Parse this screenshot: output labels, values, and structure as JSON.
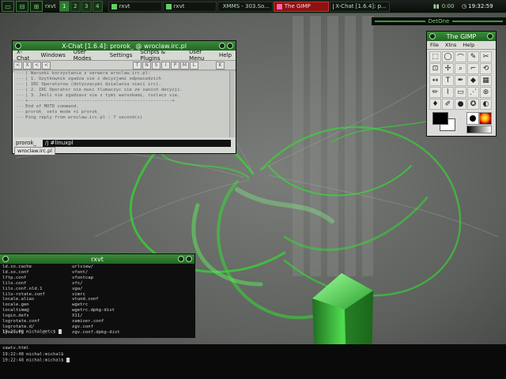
{
  "top_panel": {
    "desktop_label": "rxvt",
    "desktops": [
      "1",
      "2",
      "3",
      "4"
    ],
    "tasks": [
      {
        "label": "rxvt",
        "active": false
      },
      {
        "label": "rxvt",
        "active": false
      },
      {
        "label": "XMMS - 303.So...",
        "active": false
      },
      {
        "label": "The GIMP",
        "active": true
      },
      {
        "label": "X-Chat [1.6.4]: p...",
        "active": false
      }
    ],
    "tray_left": "0:00",
    "tray_mid": "",
    "clock": "19:32:59"
  },
  "detone": {
    "label": "DetOne"
  },
  "colors": {
    "accent": "#2f8a2f",
    "active_task": "#8a1212",
    "titlebar": "#226622"
  },
  "xchat": {
    "title": "X-Chat [1.6.4]: prorok_ @ wroclaw.irc.pl",
    "menu": [
      "X-Chat",
      "Windows",
      "User Modes",
      "Settings",
      "Scripts & Plugins",
      "User Menu",
      "Help"
    ],
    "toolbar": [
      "<",
      "X",
      "<",
      "<",
      "T",
      "N",
      "S",
      "I",
      "P",
      "M",
      "L",
      "K"
    ],
    "log": [
      {
        "nick": "---",
        "text": "| Warunki korzystania z serwera wroclaw.irc.pl:"
      },
      {
        "nick": "---",
        "text": "| 1. Uzytkownik zgadza sie z decyzjami odpowiedzich"
      },
      {
        "nick": "---",
        "text": "|    IRC Operatorow (dotyczacymi dzialania sieci irc)."
      },
      {
        "nick": "---",
        "text": "| 2. IRC Operator nie musi tlumaczyc sie ze swoich decyzji."
      },
      {
        "nick": "---",
        "text": "| 3. Jesli nie zgadzasz sie z tymi warunkami, rozlacz sie."
      },
      {
        "nick": "---",
        "text": "+------------------------------------------------------+"
      },
      {
        "nick": "---",
        "text": "End of MOTD command."
      },
      {
        "nick": "---",
        "text": "prorok_ sets mode +i prorok_"
      },
      {
        "nick": "---",
        "text": "Ping reply from wroclaw.irc.pl : 7 second(s)"
      }
    ],
    "nick": "prorok_",
    "input_value": "/j #linuxpl",
    "server_tab": "wroclaw.irc.pl"
  },
  "gimp": {
    "title": "The GIMP",
    "menu": [
      "File",
      "Xtns",
      "Help"
    ],
    "tools": [
      {
        "glyph": "⬚",
        "name": "rect-select-icon"
      },
      {
        "glyph": "◯",
        "name": "ellipse-select-icon"
      },
      {
        "glyph": "⌒",
        "name": "free-select-icon"
      },
      {
        "glyph": "✎",
        "name": "fuzzy-select-icon"
      },
      {
        "glyph": "✂",
        "name": "scissors-icon"
      },
      {
        "glyph": "⊡",
        "name": "bezier-select-icon"
      },
      {
        "glyph": "✢",
        "name": "move-icon"
      },
      {
        "glyph": "⌕",
        "name": "magnify-icon"
      },
      {
        "glyph": "⌐",
        "name": "crop-icon"
      },
      {
        "glyph": "⟲",
        "name": "transform-icon"
      },
      {
        "glyph": "↔",
        "name": "flip-icon"
      },
      {
        "glyph": "T",
        "name": "text-icon"
      },
      {
        "glyph": "✒",
        "name": "color-picker-icon"
      },
      {
        "glyph": "◆",
        "name": "bucket-fill-icon"
      },
      {
        "glyph": "▦",
        "name": "blend-icon"
      },
      {
        "glyph": "✏",
        "name": "pencil-icon"
      },
      {
        "glyph": "⌇",
        "name": "paintbrush-icon"
      },
      {
        "glyph": "▭",
        "name": "eraser-icon"
      },
      {
        "glyph": "⋰",
        "name": "airbrush-icon"
      },
      {
        "glyph": "⊛",
        "name": "clone-icon"
      },
      {
        "glyph": "♦",
        "name": "ink-icon"
      },
      {
        "glyph": "✐",
        "name": "convolve-icon"
      },
      {
        "glyph": "●",
        "name": "dodge-burn-icon"
      },
      {
        "glyph": "✪",
        "name": "smudge-icon"
      },
      {
        "glyph": "◐",
        "name": "measure-icon"
      }
    ]
  },
  "rxvt": {
    "title": "rxvt",
    "col1": [
      "ld.so.cache",
      "ld.so.conf",
      "lftp.conf",
      "lilo.conf",
      "lilo.conf.old.1",
      "lilo-rotate.conf",
      "locale.alias",
      "locale.gen",
      "localtime@",
      "login.defs",
      "logrotate.conf",
      "logrotate.d/",
      "lynx.cfg"
    ],
    "col2": [
      "urlview/",
      "vfont/",
      "vfontcap",
      "vfs/",
      "vga/",
      "vimrc",
      "vtund.conf",
      "wgetrc",
      "wgetrc.dpkg-dist",
      "X11/",
      "xamixer.conf",
      "zgv.conf",
      "zgv.conf.dpkg-dist"
    ],
    "prompt": "19:28:00 michal@etc$"
  },
  "bottom_term": {
    "lines": [
      "xawtv.html",
      "19:22:48 michal:michal$",
      "19:22:48 michal:michal$"
    ]
  }
}
